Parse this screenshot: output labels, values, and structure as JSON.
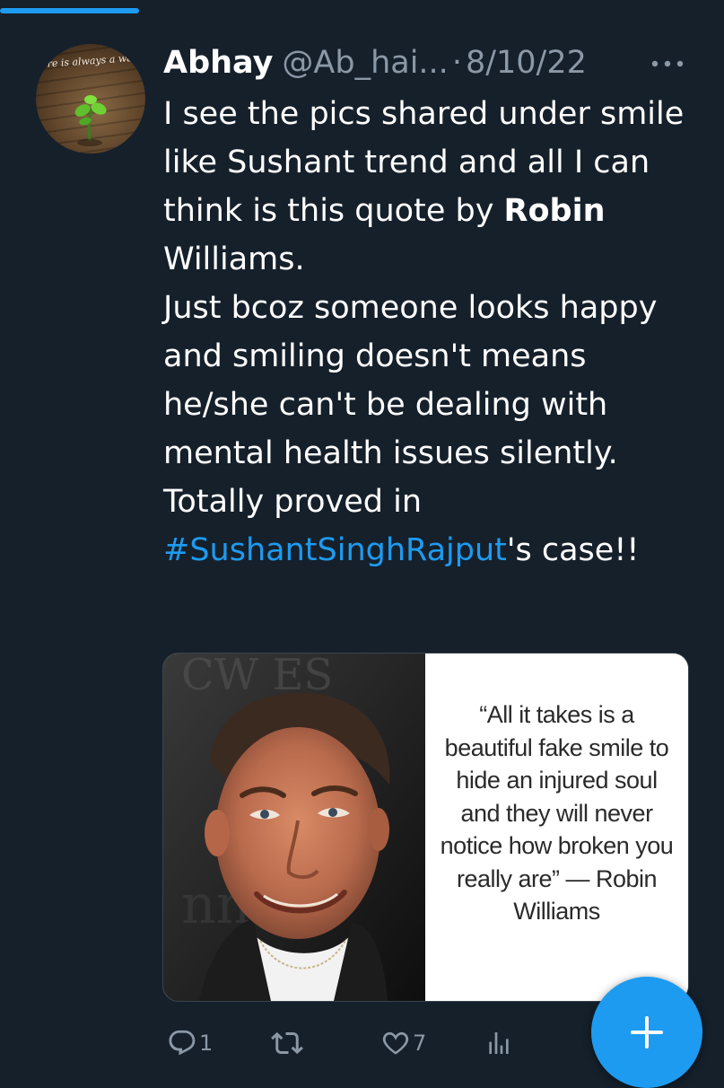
{
  "tweet": {
    "author_name": "Abhay",
    "handle": "@Ab_hai...",
    "separator": "·",
    "date": "8/10/22",
    "avatar_caption": "ere is always a way",
    "text": {
      "p1": "I see the pics shared under smile like Sushant trend and all I can think is this quote by ",
      "bold": "Robin",
      "p2": " Williams.",
      "p3": "Just bcoz someone looks happy and smiling doesn't means he/she can't be dealing with mental health issues silently. Totally proved in ",
      "hashtag": "#SushantSinghRajput",
      "p4": "'s case!!"
    },
    "media": {
      "quote": "“All it takes is a beautiful fake smile to hide an injured soul and they will never notice how broken you really are” — Robin Williams"
    },
    "actions": {
      "reply_count": "1",
      "retweet_count": "",
      "like_count": "7",
      "views_count": ""
    }
  },
  "icons": {
    "more": "more-horizontal-icon",
    "reply": "reply-icon",
    "retweet": "retweet-icon",
    "like": "heart-icon",
    "views": "views-icon",
    "compose": "plus-icon"
  },
  "colors": {
    "background": "#15202b",
    "accent": "#1d9bf0",
    "secondary_text": "#8b98a5"
  }
}
